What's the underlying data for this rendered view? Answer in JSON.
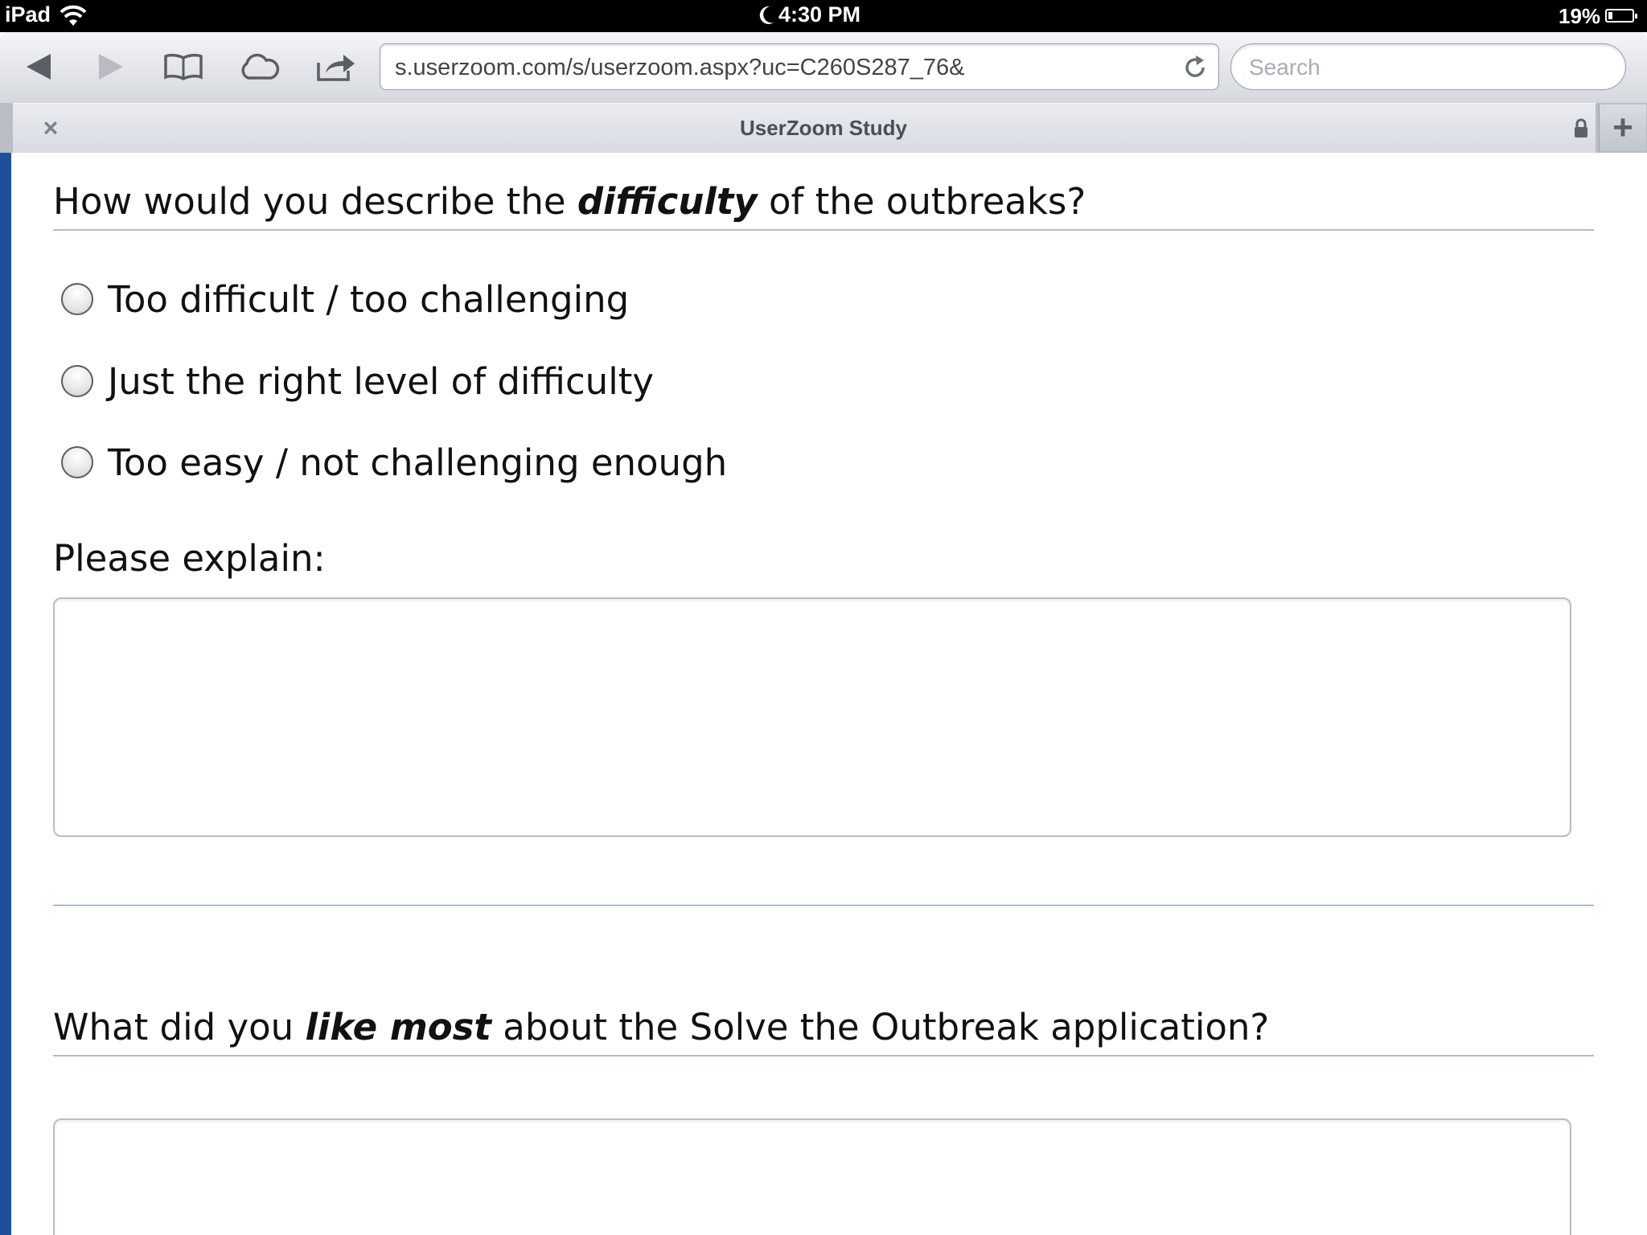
{
  "status_bar": {
    "carrier": "iPad",
    "time": "4:30 PM",
    "battery": "19%",
    "battery_level": 0.19
  },
  "browser": {
    "url": "s.userzoom.com/s/userzoom.aspx?uc=C260S287_76&",
    "search_placeholder": "Search",
    "tab_title": "UserZoom Study",
    "tab_close": "×",
    "new_tab": "+"
  },
  "survey": {
    "q1": {
      "prefix": "How would you describe the ",
      "emphasis": "difficulty",
      "suffix": " of the outbreaks?",
      "options": [
        "Too difficult / too challenging",
        "Just the right level of difficulty",
        "Too easy / not challenging enough"
      ],
      "explain_label": "Please explain:"
    },
    "q2": {
      "prefix": "What did you ",
      "emphasis": "like most",
      "suffix": " about the Solve the Outbreak application?"
    }
  }
}
